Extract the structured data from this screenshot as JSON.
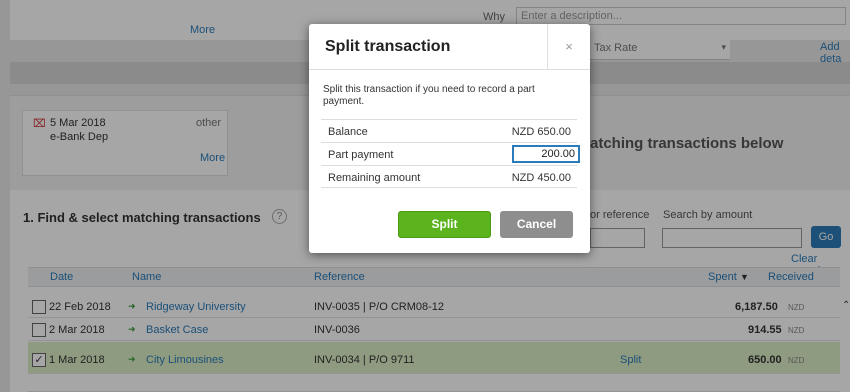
{
  "top": {
    "more_link": "More",
    "why_label": "Why",
    "why_placeholder": "Enter a description...",
    "tax_rate_label": "Tax Rate",
    "add_details": "Add deta"
  },
  "statement": {
    "remove_icon": "x-icon",
    "date": "5 Mar 2018",
    "type": "other",
    "description": "e-Bank Dep",
    "more_link": "More"
  },
  "match_heading": "atching transactions below",
  "find": {
    "title": "1. Find & select matching transactions",
    "help_icon": "?",
    "or_reference": "or reference",
    "search_by_amount": "Search by amount",
    "go_button": "Go",
    "clear_search": "Clear search"
  },
  "table": {
    "headers": {
      "date": "Date",
      "name": "Name",
      "reference": "Reference",
      "spent": "Spent",
      "sort_icon": "▼",
      "received": "Received"
    },
    "rows": [
      {
        "checked": "",
        "date": "22 Feb 2018",
        "name": "Ridgeway University",
        "reference": "INV-0035 | P/O CRM08-12",
        "spent": "",
        "received": "6,187.50",
        "currency": "NZD"
      },
      {
        "checked": "",
        "date": "2 Mar 2018",
        "name": "Basket Case",
        "reference": "INV-0036",
        "spent": "",
        "received": "914.55",
        "currency": "NZD"
      },
      {
        "checked": "✓",
        "date": "1 Mar 2018",
        "name": "City Limousines",
        "reference": "INV-0034 | P/O 9711",
        "spent": "Split",
        "received": "650.00",
        "currency": "NZD"
      }
    ]
  },
  "modal": {
    "title": "Split transaction",
    "close_icon": "×",
    "description": "Split this transaction if you need to record a part payment.",
    "balance_label": "Balance",
    "balance_value": "NZD 650.00",
    "part_payment_label": "Part payment",
    "part_payment_value": "200.00",
    "remaining_label": "Remaining amount",
    "remaining_value": "NZD 450.00",
    "split_button": "Split",
    "cancel_button": "Cancel"
  },
  "colors": {
    "link": "#2b7bb9",
    "split_button": "#5bb31d",
    "cancel_button": "#8e8e8e",
    "selected_row": "#dbefc5"
  }
}
